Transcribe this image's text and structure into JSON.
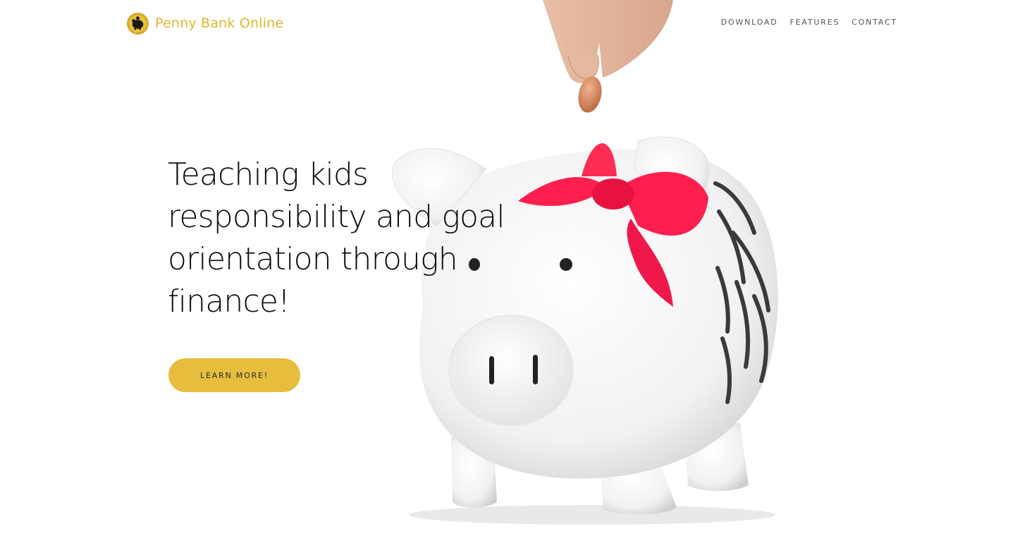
{
  "brand": {
    "name": "Penny Bank Online",
    "logo_icon": "piggy-bank-coin-icon",
    "color": "#e2b72c"
  },
  "nav": {
    "items": [
      {
        "label": "DOWNLOAD"
      },
      {
        "label": "FEATURES"
      },
      {
        "label": "CONTACT"
      }
    ]
  },
  "hero": {
    "line1": "Teaching kids",
    "line2": "responsibility and goal",
    "line3": "orientation through",
    "line4": "finance!",
    "cta_label": "LEARN MORE!",
    "cta_color": "#e6bd3d",
    "image_icon": "piggy-bank-with-coin-photo"
  }
}
